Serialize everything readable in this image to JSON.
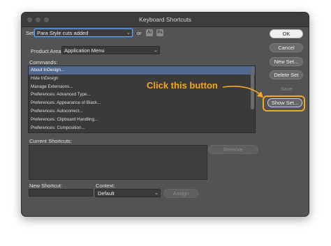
{
  "window": {
    "title": "Keyboard Shortcuts"
  },
  "set": {
    "label": "Set:",
    "value": "Para Style cuts added",
    "or_label": "or",
    "icon_ai": "Ai",
    "icon_ps": "Ps"
  },
  "product_area": {
    "label": "Product Area:",
    "value": "Application Menu"
  },
  "commands": {
    "label": "Commands:",
    "items": [
      "About InDesign...",
      "Hide InDesign",
      "Manage Extensions...",
      "Preferences: Advanced Type...",
      "Preferences: Appearance of Black...",
      "Preferences: Autocorrect...",
      "Preferences: Clipboard Handling...",
      "Preferences: Composition..."
    ],
    "selected_index": 0
  },
  "current_shortcuts": {
    "label": "Current Shortcuts:",
    "remove_label": "Remove"
  },
  "new_shortcut": {
    "label": "New Shortcut:",
    "value": ""
  },
  "context": {
    "label": "Context:",
    "value": "Default",
    "assign_label": "Assign"
  },
  "buttons": {
    "ok": "OK",
    "cancel": "Cancel",
    "new_set": "New Set...",
    "delete_set": "Delete Set",
    "save": "Save",
    "show_set": "Show Set..."
  },
  "annotation": {
    "text": "Click this button",
    "color": "#f4a81d"
  },
  "colors": {
    "dialog_bg": "#535353",
    "selection": "#51698e",
    "focus": "#6fa0dc"
  }
}
